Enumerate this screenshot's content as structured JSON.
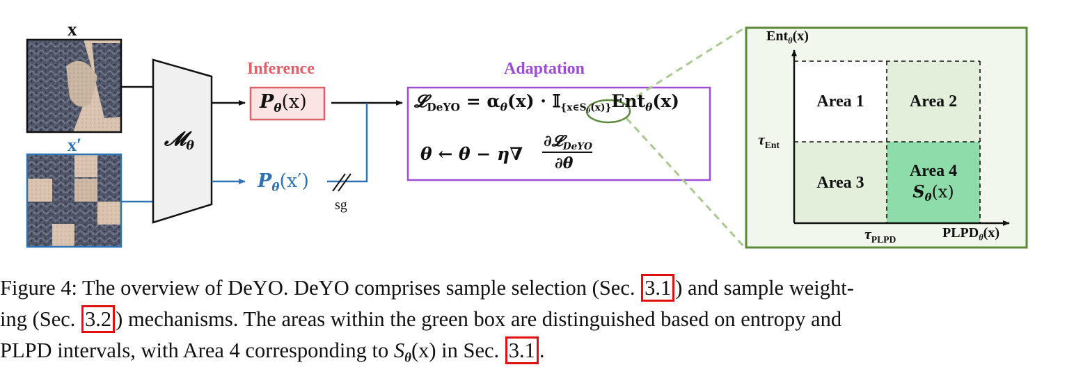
{
  "figure": {
    "input_label": "x",
    "augmented_label": "x′",
    "model_label": "𝓜",
    "model_sub": "θ",
    "inference_title": "Inference",
    "inference_box": "P",
    "inference_sub": "θ",
    "inference_arg": "(x)",
    "aug_pred": "P",
    "aug_pred_sub": "θ",
    "aug_pred_arg": "(x′)",
    "stop_grad": "sg",
    "adaptation_title": "Adaptation",
    "loss_lhs": "𝓛",
    "loss_lhs_sub": "DeYO",
    "loss_eq": "= α",
    "loss_alpha_sub": "θ",
    "loss_alpha_arg": "(x) · 𝕀",
    "loss_indicator_sub": "{x∈S",
    "loss_indicator_sub2": "θ",
    "loss_indicator_sub3": "(x)}",
    "loss_ent": "Ent",
    "loss_ent_sub": "θ",
    "loss_ent_arg": "(x)",
    "update_lhs": "θ ← θ − η∇",
    "update_num": "∂𝓛",
    "update_num_sub": "DeYO",
    "update_den": "∂θ",
    "plot": {
      "y_axis": "Ent",
      "y_axis_sub": "θ",
      "y_axis_arg": "(x)",
      "x_axis": "PLPD",
      "x_axis_sub": "θ",
      "x_axis_arg": "(x)",
      "tau_ent": "τ",
      "tau_ent_sub": "Ent",
      "tau_plpd": "τ",
      "tau_plpd_sub": "PLPD",
      "area1": "Area 1",
      "area2": "Area 2",
      "area3": "Area 3",
      "area4": "Area 4",
      "area4_set": "S",
      "area4_set_sub": "θ",
      "area4_set_arg": "(x)"
    },
    "colors": {
      "inference": "#e0606a",
      "adaptation": "#9c4fd6",
      "augmented": "#2e74b5",
      "green_frame": "#5a8a3a",
      "area_light": "#e3efdb",
      "area_dark": "#8fdcab"
    }
  },
  "caption": {
    "line1_a": "Figure 4: The overview of DeYO. DeYO comprises sample selection (Sec. ",
    "ref1": "3.1",
    "line1_b": ") and sample weight-",
    "line2_a": "ing (Sec. ",
    "ref2": "3.2",
    "line2_b": ") mechanisms. The areas within the green box are distinguished based on entropy and",
    "line3_a": "PLPD intervals, with Area 4 corresponding to ",
    "math_S": "S",
    "math_sub": "θ",
    "math_arg": "(x)",
    "line3_b": " in Sec. ",
    "ref3": "3.1",
    "line3_c": "."
  }
}
